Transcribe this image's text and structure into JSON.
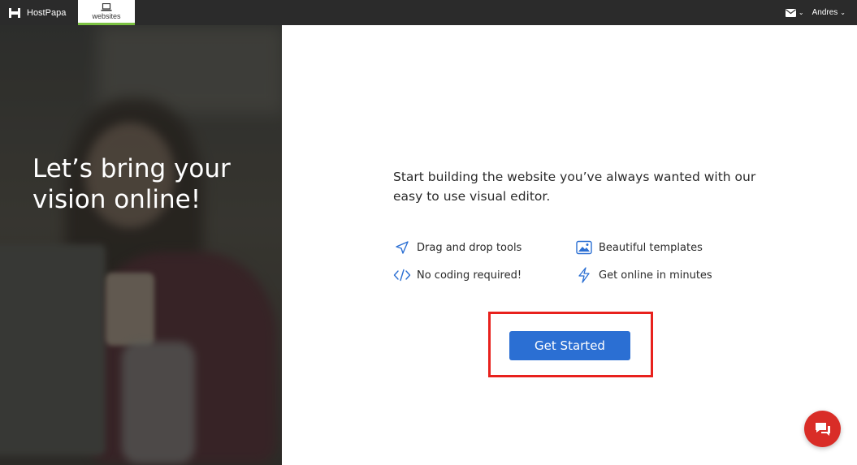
{
  "topbar": {
    "brand_name": "HostPapa",
    "tab_label": "websites",
    "user_name": "Andres",
    "chevron": "⌄",
    "icons": {
      "brand": "hostpapa-logo-icon",
      "tab": "laptop-icon",
      "mail": "mail-icon"
    },
    "colors": {
      "bar": "#2b2b2b",
      "tab_accent": "#7cc242"
    }
  },
  "hero": {
    "headline": "Let’s bring your vision online!"
  },
  "main": {
    "intro": "Start building the website you’ve always wanted with our easy to use visual editor.",
    "features": [
      {
        "label": "Drag and drop tools",
        "icon": "paper-plane-icon"
      },
      {
        "label": "Beautiful templates",
        "icon": "image-icon"
      },
      {
        "label": "No coding required!",
        "icon": "code-icon"
      },
      {
        "label": "Get online in minutes",
        "icon": "lightning-icon"
      }
    ],
    "cta_label": "Get Started",
    "colors": {
      "cta": "#2b6fd3",
      "icons": "#2b6fd3",
      "highlight": "#e8211d"
    }
  },
  "chat": {
    "icon": "chat-icon",
    "color": "#d92d27"
  }
}
